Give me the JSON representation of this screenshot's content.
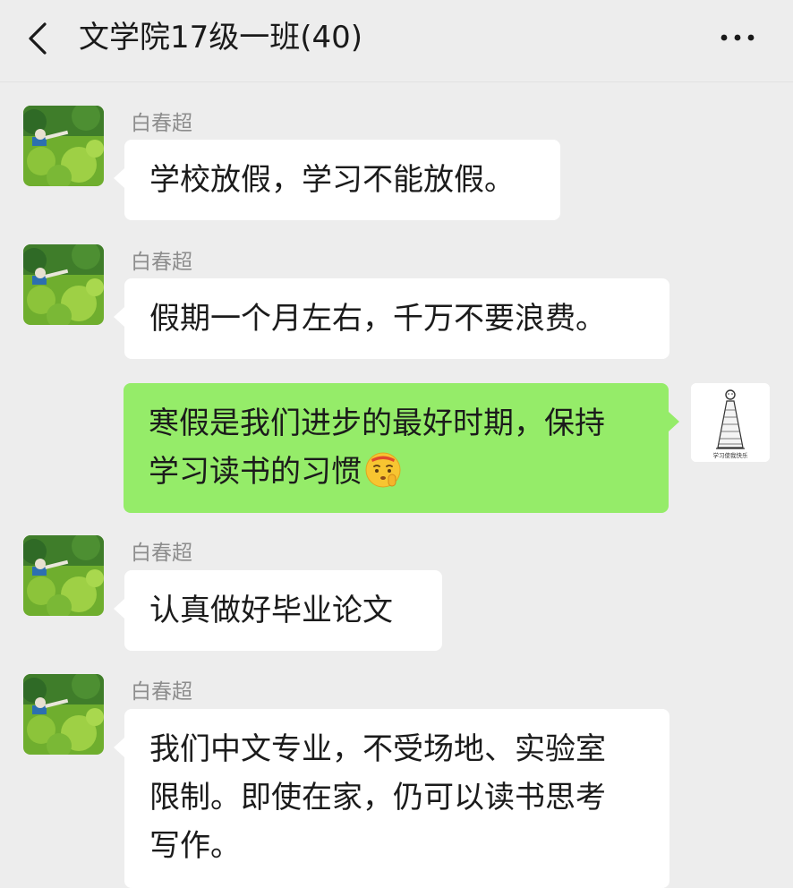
{
  "header": {
    "title": "文学院17级一班(40)"
  },
  "icons": {
    "back": "chevron-left-icon",
    "more": "more-horizontal-icon",
    "emoji": "shushing-face-emoji"
  },
  "colors": {
    "background": "#ededed",
    "bubble_in": "#ffffff",
    "bubble_out": "#95ec69",
    "sender_name": "#8d8d8d"
  },
  "self_avatar": {
    "caption": "学习使我快乐"
  },
  "messages": [
    {
      "sender": "白春超",
      "lines": [
        "学校放假，学习不能放假。"
      ]
    },
    {
      "sender": "白春超",
      "lines": [
        "假期一个月左右，千万不要浪费。"
      ]
    },
    {
      "sender": "self",
      "lines": [
        "寒假是我们进步的最好时期，保持",
        "学习读书的习惯"
      ]
    },
    {
      "sender": "白春超",
      "lines": [
        "认真做好毕业论文"
      ]
    },
    {
      "sender": "白春超",
      "lines": [
        "我们中文专业，不受场地、实验室",
        "限制。即使在家，仍可以读书思考",
        "写作。"
      ]
    }
  ]
}
